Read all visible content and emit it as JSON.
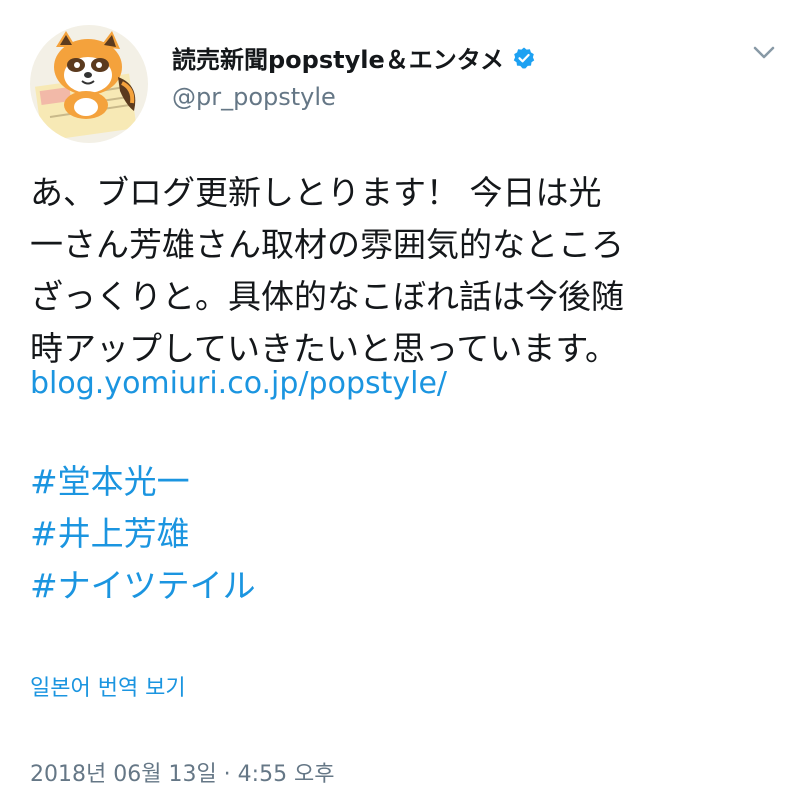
{
  "author": {
    "display_name": "読売新聞popstyle＆エンタメ",
    "handle": "@pr_popstyle",
    "verified": true,
    "avatar_icon": "raccoon-mascot-avatar"
  },
  "menu_icon": "chevron-down-icon",
  "tweet": {
    "lines": [
      "あ、ブログ更新しとります！ 今日は光",
      "一さん芳雄さん取材の雰囲気的なところ",
      "ざっくりと。具体的なこぼれ話は今後随",
      "時アップしていきたいと思っています。"
    ],
    "link": "blog.yomiuri.co.jp/popstyle/",
    "hashtags": [
      "#堂本光一",
      "#井上芳雄",
      "#ナイツテイル"
    ]
  },
  "translate_label": "일본어 번역 보기",
  "timestamp": "2018년 06월 13일 · 4:55 오후",
  "colors": {
    "link": "#1b95e0",
    "text": "#14171a",
    "secondary": "#657786",
    "verified": "#1da1f2"
  }
}
